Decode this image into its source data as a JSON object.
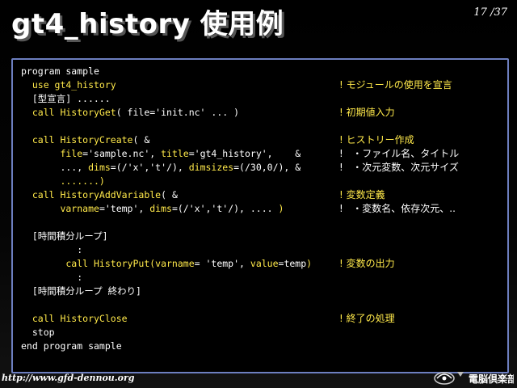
{
  "slide": {
    "title": "gt4_history 使用例",
    "page_number": "17 /37"
  },
  "code_lines": [
    [
      {
        "t": "program sample",
        "c": "w"
      }
    ],
    [
      {
        "t": "  use gt4_history",
        "c": "y"
      }
    ],
    [
      {
        "t": "  [型宣言] ......",
        "c": "w"
      }
    ],
    [
      {
        "t": "  call HistoryGet",
        "c": "y"
      },
      {
        "t": "( file='init.nc' ... )",
        "c": "w"
      }
    ],
    [
      {
        "t": "",
        "c": "w"
      }
    ],
    [
      {
        "t": "  call HistoryCreate",
        "c": "y"
      },
      {
        "t": "( &",
        "c": "w"
      }
    ],
    [
      {
        "t": "       file",
        "c": "y"
      },
      {
        "t": "='sample.nc', ",
        "c": "w"
      },
      {
        "t": "title",
        "c": "y"
      },
      {
        "t": "='gt4_history',    &",
        "c": "w"
      }
    ],
    [
      {
        "t": "       ..., ",
        "c": "w"
      },
      {
        "t": "dims",
        "c": "y"
      },
      {
        "t": "=(/'x','t'/), ",
        "c": "w"
      },
      {
        "t": "dimsizes",
        "c": "y"
      },
      {
        "t": "=(/30,0/), &",
        "c": "w"
      }
    ],
    [
      {
        "t": "       .......)",
        "c": "y"
      }
    ],
    [
      {
        "t": "  call HistoryAddVariable",
        "c": "y"
      },
      {
        "t": "( &",
        "c": "w"
      }
    ],
    [
      {
        "t": "       varname",
        "c": "y"
      },
      {
        "t": "='temp', ",
        "c": "w"
      },
      {
        "t": "dims",
        "c": "y"
      },
      {
        "t": "=(/'x','t'/), .... ",
        "c": "w"
      },
      {
        "t": ")",
        "c": "y"
      }
    ],
    [
      {
        "t": "",
        "c": "w"
      }
    ],
    [
      {
        "t": "  [時間積分ループ]",
        "c": "w"
      }
    ],
    [
      {
        "t": "          :",
        "c": "w"
      }
    ],
    [
      {
        "t": "        call HistoryPut(varname",
        "c": "y"
      },
      {
        "t": "= 'temp', ",
        "c": "w"
      },
      {
        "t": "value",
        "c": "y"
      },
      {
        "t": "=temp",
        "c": "w"
      },
      {
        "t": ")",
        "c": "y"
      }
    ],
    [
      {
        "t": "          :",
        "c": "w"
      }
    ],
    [
      {
        "t": "  [時間積分ループ 終わり]",
        "c": "w"
      }
    ],
    [
      {
        "t": "",
        "c": "w"
      }
    ],
    [
      {
        "t": "  call HistoryClose",
        "c": "y"
      }
    ],
    [
      {
        "t": "  stop",
        "c": "w"
      }
    ],
    [
      {
        "t": "end program sample",
        "c": "w"
      }
    ]
  ],
  "comments": [
    {
      "line": 1,
      "t": "! モジュールの使用を宣言",
      "c": "y"
    },
    {
      "line": 3,
      "t": "! 初期値入力",
      "c": "y"
    },
    {
      "line": 5,
      "t": "! ヒストリー作成",
      "c": "y"
    },
    {
      "line": 6,
      "t": "!   ・ファイル名、タイトル",
      "c": "w"
    },
    {
      "line": 7,
      "t": "!   ・次元変数、次元サイズ",
      "c": "w"
    },
    {
      "line": 9,
      "t": "! 変数定義",
      "c": "y"
    },
    {
      "line": 10,
      "t": "!   ・変数名、依存次元、..",
      "c": "w"
    },
    {
      "line": 14,
      "t": "! 変数の出力",
      "c": "y"
    },
    {
      "line": 18,
      "t": "! 終了の処理",
      "c": "y"
    }
  ],
  "footer": {
    "url": "http://www.gfd-dennou.org",
    "logo_text": "電脳倶楽部"
  },
  "colors": {
    "keyword": "#ffe94a",
    "text": "#ffffff",
    "box_border": "#6d7fc0"
  }
}
